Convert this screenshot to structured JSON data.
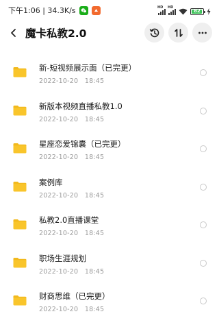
{
  "status_bar": {
    "time_speed": "下午1:06 | 34.3K/s",
    "app_icons": [
      "wechat-icon",
      "notification-app-icon"
    ],
    "signal1_label": "HD",
    "signal2_label": "HD",
    "battery_level": "82"
  },
  "header": {
    "title": "魔卡私教2.0",
    "back_icon": "chevron-left-icon",
    "history_icon": "history-icon",
    "sort_icon": "sort-icon",
    "more_icon": "more-icon"
  },
  "files": [
    {
      "name": "新-短视频展示面（已完更）",
      "date": "2022-10-20　18:45"
    },
    {
      "name": "新版本视频直播私教1.0",
      "date": "2022-10-20　18:45"
    },
    {
      "name": "星座恋爱锦囊（已完更）",
      "date": "2022-10-20　18:45"
    },
    {
      "name": "案例库",
      "date": "2022-10-20　18:45"
    },
    {
      "name": "私教2.0直播课堂",
      "date": "2022-10-20　18:45"
    },
    {
      "name": "职场生涯规划",
      "date": "2022-10-20　18:45"
    },
    {
      "name": "财商思维（已完更）",
      "date": "2022-10-20　18:45"
    }
  ],
  "colors": {
    "folder": "#f9c52b",
    "folder_tab": "#f2b91d",
    "date_text": "#9a9a9a",
    "button_bg": "#efefef"
  }
}
